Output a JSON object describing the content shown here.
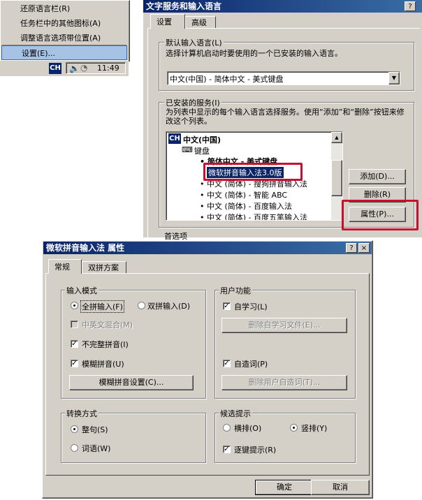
{
  "context_menu": {
    "items": [
      "还原语言栏(R)",
      "任务栏中的其他图标(A)",
      "调整语言选项带位置(A)",
      "设置(E)..."
    ],
    "selected_index": 3
  },
  "taskbar": {
    "lang": "CH",
    "time": "11:49"
  },
  "text_services": {
    "title": "文字服务和输入语言",
    "help_btn": "?",
    "close_btn": "×",
    "tabs": [
      "设置",
      "高级"
    ],
    "default_lang": {
      "label": "默认输入语言(L)",
      "desc": "选择计算机启动时要使用的一个已安装的输入语言。",
      "value": "中文(中国) - 简体中文 - 美式键盘"
    },
    "installed": {
      "label": "已安装的服务(I)",
      "desc": "为列表中显示的每个输入语言选择服务。使用“添加”和“删除”按钮来修改这个列表。",
      "lang_badge": "CH",
      "lang_name": "中文(中国)",
      "keyboard": "键盘",
      "services": [
        "简体中文 - 美式键盘",
        "微软拼音输入法3.0版",
        "中文 (简体) - 搜狗拼音输入法",
        "中文 (简体) - 智能 ABC",
        "中文 (简体) - 百度输入法",
        "中文 (简体) - 百度五笔输入法"
      ],
      "add_btn": "添加(D)...",
      "remove_btn": "删除(R)",
      "props_btn": "属性(P)..."
    },
    "prefs_label": "首选项"
  },
  "ime_props": {
    "title": "微软拼音输入法 属性",
    "help_btn": "?",
    "close_btn": "×",
    "tabs": [
      "常规",
      "双拼方案"
    ],
    "input_mode": {
      "label": "输入模式",
      "full_pinyin": "全拼输入(F)",
      "double_pinyin": "双拼输入(D)",
      "mixed": "中英文混合(M)",
      "incomplete": "不完整拼音(I)",
      "fuzzy": "模糊拼音(U)",
      "fuzzy_settings": "模糊拼音设置(C)..."
    },
    "user_func": {
      "label": "用户功能",
      "self_learn": "自学习(L)",
      "del_learn": "删除自学习文件(E)...",
      "user_words": "自造词(P)",
      "del_user_words": "删除用户自造词(T)..."
    },
    "convert": {
      "label": "转换方式",
      "sentence": "整句(S)",
      "word": "词语(W)"
    },
    "candidate": {
      "label": "候选提示",
      "horizontal": "横排(O)",
      "vertical": "竖排(Y)",
      "stepwise": "逐键提示(R)"
    },
    "ok_btn": "确定",
    "cancel_btn": "取消"
  }
}
